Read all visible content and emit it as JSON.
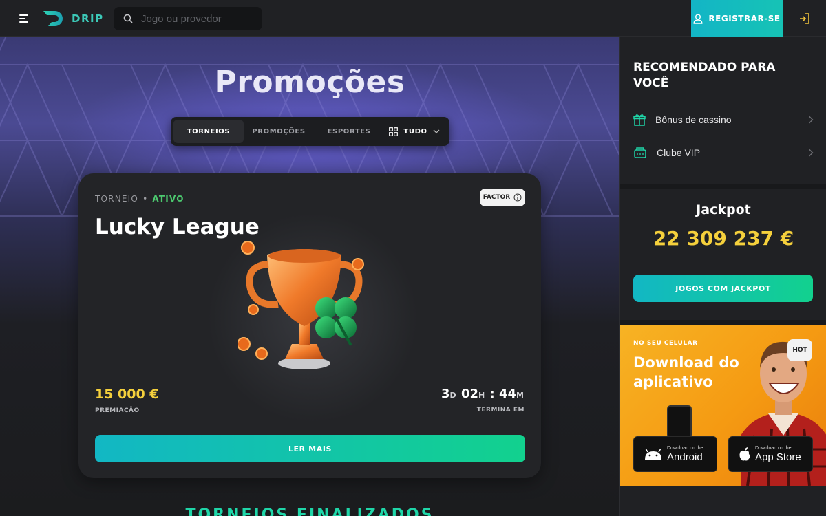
{
  "header": {
    "logo_text": "DRIP",
    "search_placeholder": "Jogo ou provedor",
    "register_label": "REGISTRAR-SE"
  },
  "main": {
    "page_title": "Promoções",
    "tabs": [
      {
        "label": "TORNEIOS",
        "active": true
      },
      {
        "label": "PROMOÇÕES",
        "active": false
      },
      {
        "label": "ESPORTES",
        "active": false
      }
    ],
    "filter_label": "TUDO",
    "card": {
      "category": "TORNEIO",
      "separator": "•",
      "status": "ATIVO",
      "badge": "FACTOR",
      "title": "Lucky League",
      "prize_amount": "15 000 €",
      "prize_label": "PREMIAÇÃO",
      "timer": {
        "days": "3",
        "days_unit": "D",
        "hours": "02",
        "hours_unit": "H",
        "sep": ":",
        "minutes": "44",
        "minutes_unit": "M"
      },
      "timer_label": "TERMINA EM",
      "button_label": "LER MAIS"
    },
    "finished_title": "TORNEIOS FINALIZADOS"
  },
  "sidebar": {
    "recommended_title": "RECOMENDADO PARA VOCÊ",
    "recommended_items": [
      {
        "label": "Bônus de cassino",
        "icon": "gift-icon"
      },
      {
        "label": "Clube VIP",
        "icon": "vip-icon"
      }
    ],
    "jackpot_title": "Jackpot",
    "jackpot_amount": "22 309 237 €",
    "jackpot_button": "JOGOS COM JACKPOT",
    "promo": {
      "eyebrow": "NO SEU CELULAR",
      "headline": "Download do aplicativo",
      "badge": "HOT",
      "android_small": "Download on the",
      "android_big": "Android",
      "ios_small": "Download on the",
      "ios_big": "App Store"
    }
  },
  "colors": {
    "accent_teal": "#13b5c6",
    "accent_green": "#12d18e",
    "gold": "#f5d03c",
    "active_green": "#4cc96f",
    "sidebar_bg": "#202124"
  }
}
